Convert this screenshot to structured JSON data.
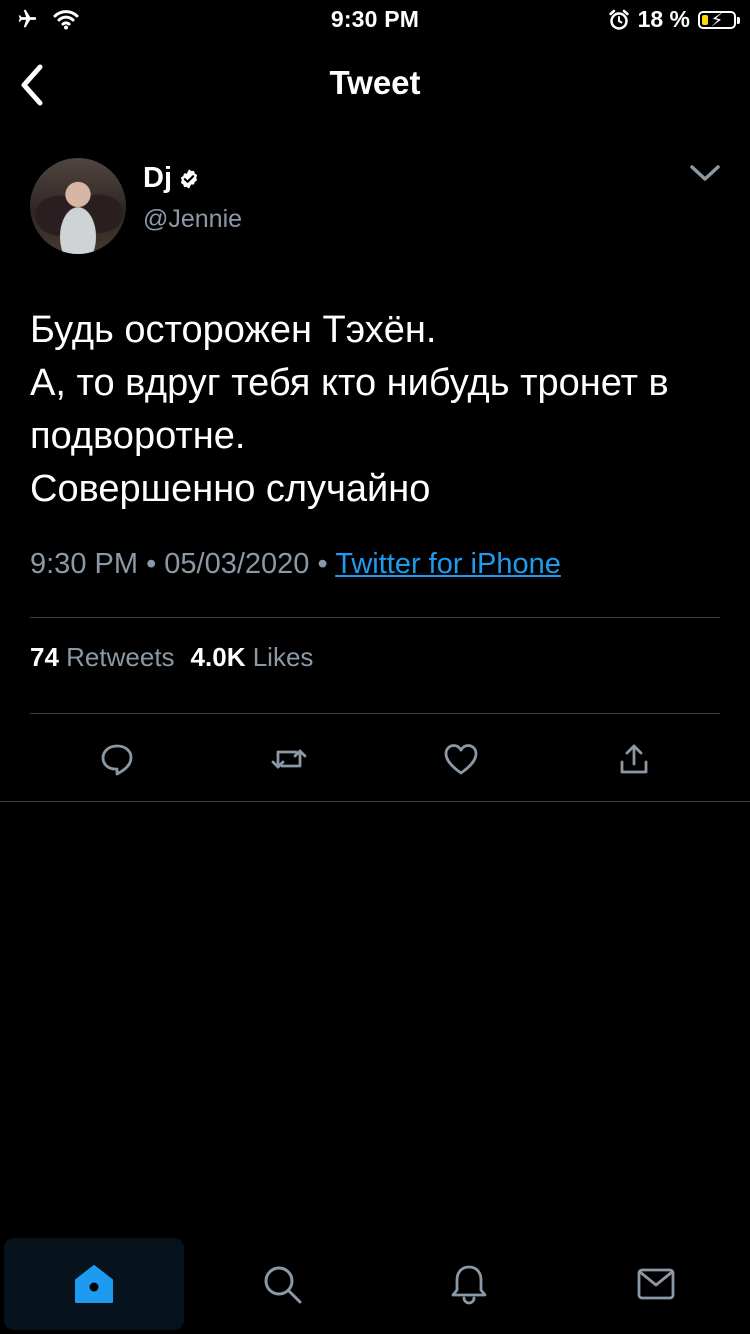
{
  "status_bar": {
    "time": "9:30 PM",
    "battery_percent": "18 %",
    "icons": [
      "airplane-icon",
      "wifi-icon",
      "alarm-icon",
      "battery-icon"
    ]
  },
  "nav": {
    "title": "Tweet",
    "back_icon": "chevron-left-icon"
  },
  "tweet": {
    "author": {
      "display_name": "Dj",
      "handle": "@Jennie",
      "verified": true
    },
    "text": "Будь осторожен Тэхён.\nА, то вдруг тебя кто нибудь тронет в подворотне.\nСовершенно случайно",
    "time": "9:30 PM",
    "separator": "•",
    "date": "05/03/2020",
    "source": "Twitter for iPhone",
    "stats": {
      "retweets_count": "74",
      "retweets_label": "Retweets",
      "likes_count": "4.0K",
      "likes_label": "Likes"
    },
    "actions": [
      "reply-icon",
      "retweet-icon",
      "like-icon",
      "share-icon"
    ]
  },
  "tab_bar": {
    "items": [
      {
        "name": "home",
        "icon": "home-icon",
        "active": true
      },
      {
        "name": "search",
        "icon": "search-icon",
        "active": false
      },
      {
        "name": "notifications",
        "icon": "bell-icon",
        "active": false
      },
      {
        "name": "messages",
        "icon": "mail-icon",
        "active": false
      }
    ]
  },
  "colors": {
    "background": "#000000",
    "accent": "#1d9bf0",
    "secondary_text": "#8b98a5",
    "divider": "#3a3d42",
    "battery_low": "#ffd60a"
  }
}
